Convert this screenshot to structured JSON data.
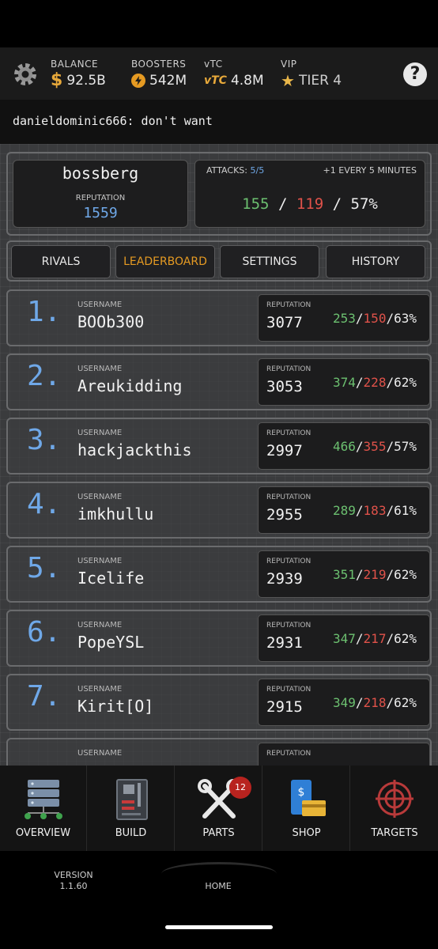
{
  "status": {
    "balance": {
      "label": "BALANCE",
      "value": "92.5B"
    },
    "boosters": {
      "label": "BOOSTERS",
      "value": "542M"
    },
    "vtc": {
      "label": "vTC",
      "mark": "vTC",
      "value": "4.8M"
    },
    "vip": {
      "label": "VIP",
      "value": "TIER 4"
    }
  },
  "message": "danieldominic666: don't want",
  "player": {
    "name": "bossberg",
    "reputation_label": "REPUTATION",
    "reputation": "1559"
  },
  "attacks": {
    "label": "ATTACKS:",
    "count": "5/5",
    "regen": "+1 EVERY 5 MINUTES",
    "wins": "155",
    "losses": "119",
    "ratio": "57%"
  },
  "tabs": [
    "RIVALS",
    "LEADERBOARD",
    "SETTINGS",
    "HISTORY"
  ],
  "leaderboard": {
    "username_label": "USERNAME",
    "reputation_label": "REPUTATION",
    "rows": [
      {
        "rank": "1.",
        "username": "BOOb300",
        "reputation": "3077",
        "wins": "253",
        "losses": "150",
        "ratio": "63%"
      },
      {
        "rank": "2.",
        "username": "Areukidding",
        "reputation": "3053",
        "wins": "374",
        "losses": "228",
        "ratio": "62%"
      },
      {
        "rank": "3.",
        "username": "hackjackthis",
        "reputation": "2997",
        "wins": "466",
        "losses": "355",
        "ratio": "57%"
      },
      {
        "rank": "4.",
        "username": "imkhullu",
        "reputation": "2955",
        "wins": "289",
        "losses": "183",
        "ratio": "61%"
      },
      {
        "rank": "5.",
        "username": "Icelife",
        "reputation": "2939",
        "wins": "351",
        "losses": "219",
        "ratio": "62%"
      },
      {
        "rank": "6.",
        "username": "PopeYSL",
        "reputation": "2931",
        "wins": "347",
        "losses": "217",
        "ratio": "62%"
      },
      {
        "rank": "7.",
        "username": "Kirit[O]",
        "reputation": "2915",
        "wins": "349",
        "losses": "218",
        "ratio": "62%"
      }
    ]
  },
  "nav": [
    {
      "label": "OVERVIEW",
      "icon": "servers-icon"
    },
    {
      "label": "BUILD",
      "icon": "motherboard-icon"
    },
    {
      "label": "PARTS",
      "icon": "tools-icon",
      "badge": "12"
    },
    {
      "label": "SHOP",
      "icon": "shop-icon"
    },
    {
      "label": "TARGETS",
      "icon": "crosshair-icon"
    }
  ],
  "footer": {
    "version_label": "VERSION",
    "version": "1.1.60",
    "home_label": "HOME"
  },
  "colors": {
    "accent": "#e59a22",
    "win": "#6cc070",
    "loss": "#e0524a",
    "rank": "#6fa8e8"
  }
}
